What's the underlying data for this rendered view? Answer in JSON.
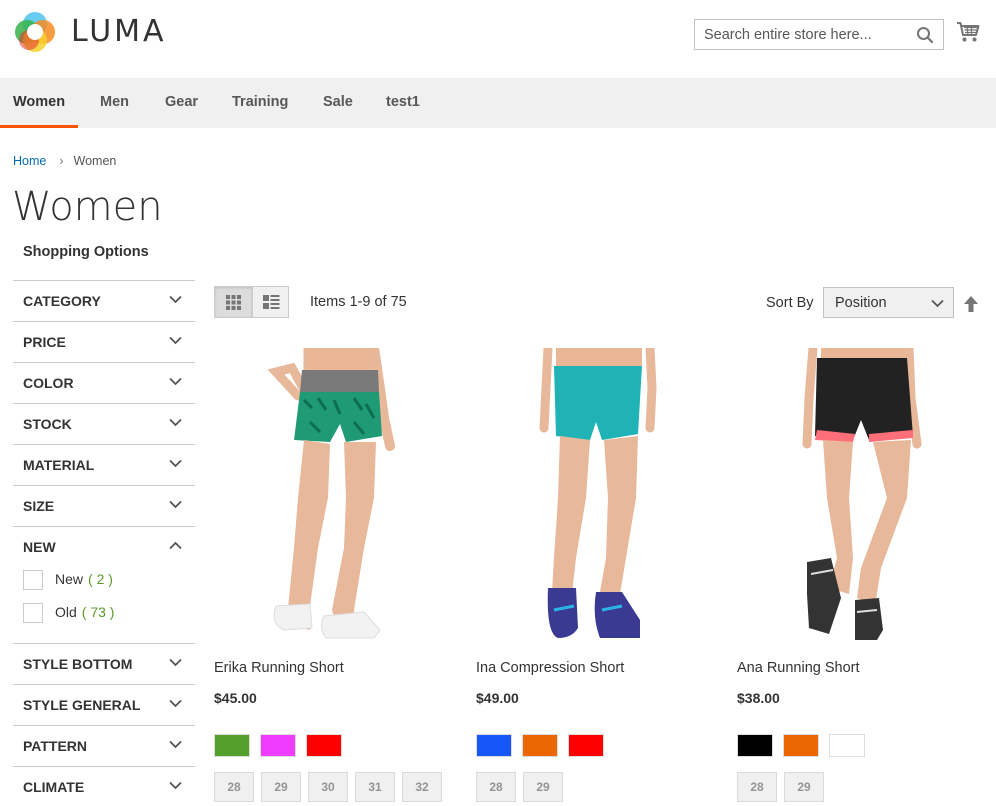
{
  "brand": {
    "name": "LUMA"
  },
  "search": {
    "placeholder": "Search entire store here..."
  },
  "nav": [
    "Women",
    "Men",
    "Gear",
    "Training",
    "Sale",
    "test1"
  ],
  "breadcrumb": {
    "home": "Home",
    "current": "Women"
  },
  "page": {
    "title": "Women"
  },
  "sidebar": {
    "title": "Shopping Options",
    "filters": [
      "CATEGORY",
      "PRICE",
      "COLOR",
      "STOCK",
      "MATERIAL",
      "SIZE",
      "NEW",
      "STYLE BOTTOM",
      "STYLE GENERAL",
      "PATTERN",
      "CLIMATE"
    ],
    "new_options": [
      {
        "label": "New",
        "count": "( 2 )"
      },
      {
        "label": "Old",
        "count": "( 73 )"
      }
    ]
  },
  "toolbar": {
    "items": "Items 1-9 of 75",
    "sort_label": "Sort By",
    "sort_value": "Position"
  },
  "products": [
    {
      "name": "Erika Running Short",
      "price": "$45.00",
      "swatches": [
        "#53a02d",
        "#ef3dff",
        "#ff0000"
      ],
      "sizes": [
        "28",
        "29",
        "30",
        "31",
        "32"
      ]
    },
    {
      "name": "Ina Compression Short",
      "price": "$49.00",
      "swatches": [
        "#1857f7",
        "#eb6703",
        "#ff0000"
      ],
      "sizes": [
        "28",
        "29"
      ]
    },
    {
      "name": "Ana Running Short",
      "price": "$38.00",
      "swatches": [
        "#000000",
        "#eb6703",
        "#ffffff"
      ],
      "sizes": [
        "28",
        "29"
      ]
    }
  ],
  "colors": {
    "accent": "#ff5501",
    "link": "#006bb4",
    "count": "#5a9b2e"
  }
}
